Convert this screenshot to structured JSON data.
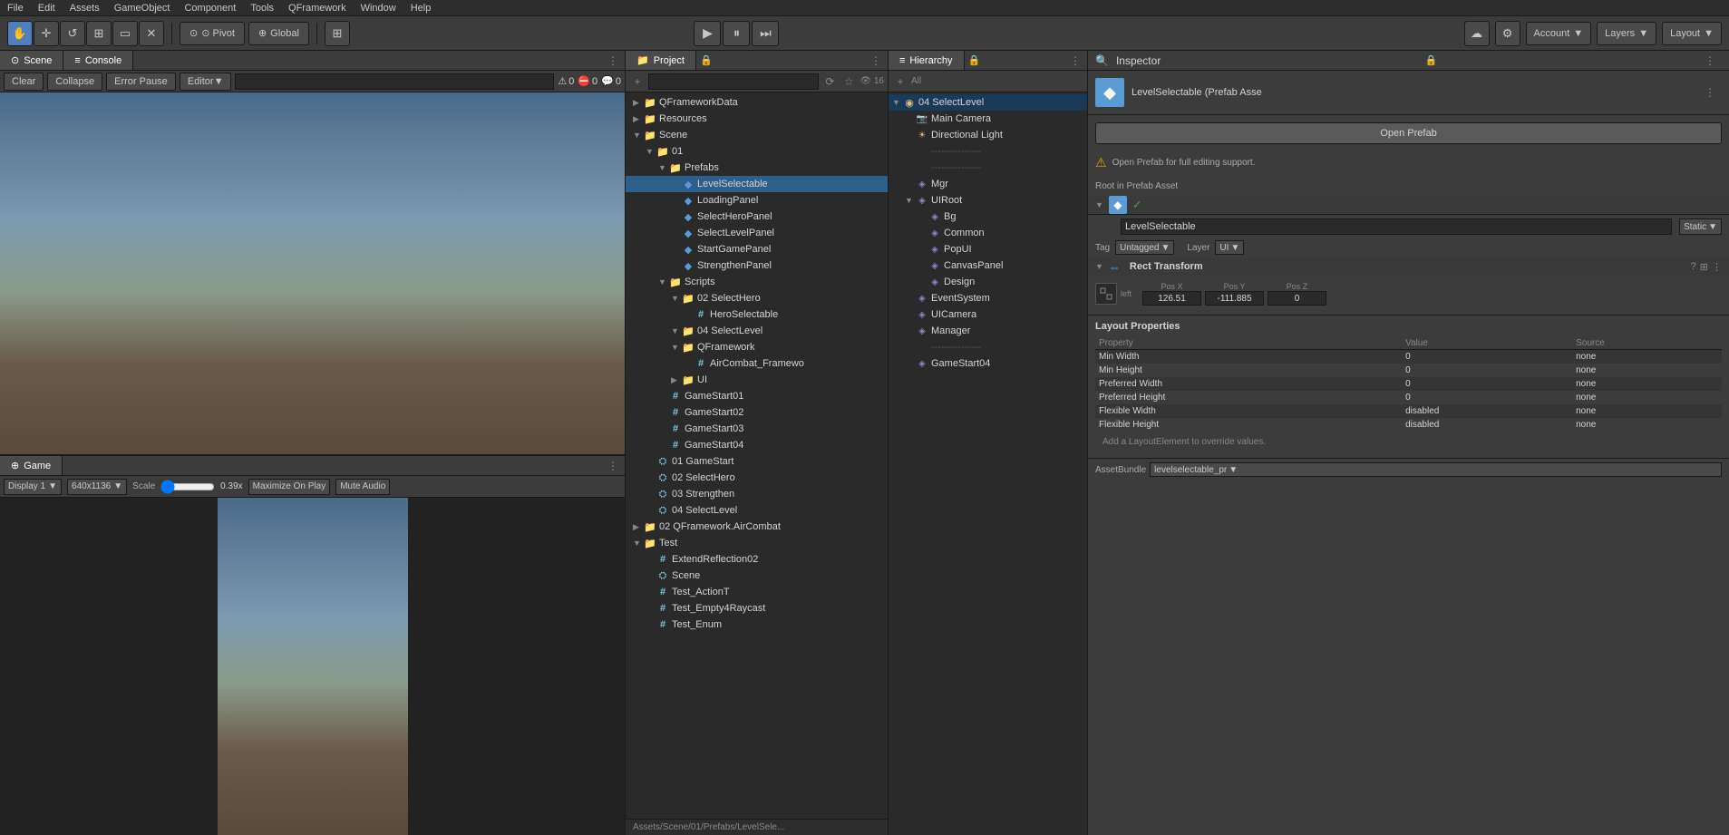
{
  "menubar": {
    "items": [
      "File",
      "Edit",
      "Assets",
      "GameObject",
      "Component",
      "Tools",
      "QFramework",
      "Window",
      "Help"
    ]
  },
  "toolbar": {
    "tools": [
      {
        "name": "hand",
        "icon": "✋",
        "active": true
      },
      {
        "name": "move",
        "icon": "✛",
        "active": false
      },
      {
        "name": "rotate",
        "icon": "↺",
        "active": false
      },
      {
        "name": "scale",
        "icon": "⊞",
        "active": false
      },
      {
        "name": "rect",
        "icon": "▭",
        "active": false
      },
      {
        "name": "transform",
        "icon": "✕",
        "active": false
      }
    ],
    "pivot_label": "⊙ Pivot",
    "global_label": "⊕ Global",
    "collab_icon": "⊞",
    "account_label": "Account",
    "layers_label": "Layers",
    "layout_label": "Layout"
  },
  "play_controls": {
    "play_icon": "▶",
    "pause_icon": "⏸",
    "step_icon": "⏭"
  },
  "scene_tab": {
    "label": "Scene",
    "icon": "⊙"
  },
  "console_tab": {
    "label": "Console",
    "icon": "≡"
  },
  "console_toolbar": {
    "clear_label": "Clear",
    "collapse_label": "Collapse",
    "error_pause_label": "Error Pause",
    "editor_label": "Editor",
    "search_placeholder": "",
    "warn_count": "0",
    "error_count": "0",
    "msg_count": "0"
  },
  "game_tab": {
    "label": "Game",
    "icon": "⊕",
    "display_label": "Display 1",
    "resolution_label": "640x1136",
    "scale_label": "Scale",
    "scale_value": "0.39x",
    "maximize_label": "Maximize On Play",
    "mute_label": "Mute Audio"
  },
  "project_panel": {
    "title": "Project",
    "icon": "📁",
    "count": "16",
    "search_placeholder": "",
    "tree": [
      {
        "id": "qframeworkdata",
        "label": "QFrameworkData",
        "type": "folder",
        "indent": 0,
        "expanded": false,
        "arrow": "▶"
      },
      {
        "id": "resources",
        "label": "Resources",
        "type": "folder",
        "indent": 0,
        "expanded": false,
        "arrow": "▶"
      },
      {
        "id": "scene",
        "label": "Scene",
        "type": "folder",
        "indent": 0,
        "expanded": true,
        "arrow": "▼"
      },
      {
        "id": "01",
        "label": "01",
        "type": "folder",
        "indent": 1,
        "expanded": true,
        "arrow": "▼"
      },
      {
        "id": "prefabs",
        "label": "Prefabs",
        "type": "folder",
        "indent": 2,
        "expanded": true,
        "arrow": "▼"
      },
      {
        "id": "levelselectable",
        "label": "LevelSelectable",
        "type": "prefab",
        "indent": 3,
        "expanded": false,
        "arrow": "",
        "selected": true
      },
      {
        "id": "loadingpanel",
        "label": "LoadingPanel",
        "type": "prefab",
        "indent": 3,
        "expanded": false,
        "arrow": ""
      },
      {
        "id": "selectheropanel",
        "label": "SelectHeroPanel",
        "type": "prefab",
        "indent": 3,
        "expanded": false,
        "arrow": ""
      },
      {
        "id": "selectlevelpanel",
        "label": "SelectLevelPanel",
        "type": "prefab",
        "indent": 3,
        "expanded": false,
        "arrow": ""
      },
      {
        "id": "startgamepanel",
        "label": "StartGamePanel",
        "type": "prefab",
        "indent": 3,
        "expanded": false,
        "arrow": ""
      },
      {
        "id": "strengthenpanel",
        "label": "StrengthenPanel",
        "type": "prefab",
        "indent": 3,
        "expanded": false,
        "arrow": ""
      },
      {
        "id": "scripts",
        "label": "Scripts",
        "type": "folder",
        "indent": 2,
        "expanded": true,
        "arrow": "▼"
      },
      {
        "id": "02selecthero",
        "label": "02 SelectHero",
        "type": "folder",
        "indent": 3,
        "expanded": true,
        "arrow": "▼"
      },
      {
        "id": "heroselectable",
        "label": "HeroSelectable",
        "type": "script",
        "indent": 4,
        "expanded": false,
        "arrow": ""
      },
      {
        "id": "04selectlevel",
        "label": "04 SelectLevel",
        "type": "folder",
        "indent": 3,
        "expanded": true,
        "arrow": "▼"
      },
      {
        "id": "qframework",
        "label": "QFramework",
        "type": "folder",
        "indent": 3,
        "expanded": true,
        "arrow": "▼"
      },
      {
        "id": "aircombat",
        "label": "AirCombat_Framewo",
        "type": "script",
        "indent": 4,
        "expanded": false,
        "arrow": ""
      },
      {
        "id": "ui",
        "label": "UI",
        "type": "folder",
        "indent": 3,
        "expanded": false,
        "arrow": "▶"
      },
      {
        "id": "gamestart01",
        "label": "GameStart01",
        "type": "script",
        "indent": 2,
        "expanded": false,
        "arrow": ""
      },
      {
        "id": "gamestart02",
        "label": "GameStart02",
        "type": "script",
        "indent": 2,
        "expanded": false,
        "arrow": ""
      },
      {
        "id": "gamestart03",
        "label": "GameStart03",
        "type": "script",
        "indent": 2,
        "expanded": false,
        "arrow": ""
      },
      {
        "id": "gamestart04",
        "label": "GameStart04",
        "type": "script",
        "indent": 2,
        "expanded": false,
        "arrow": ""
      },
      {
        "id": "01gamestart",
        "label": "01 GameStart",
        "type": "scene",
        "indent": 1,
        "expanded": false,
        "arrow": ""
      },
      {
        "id": "02selecthero2",
        "label": "02 SelectHero",
        "type": "scene",
        "indent": 1,
        "expanded": false,
        "arrow": ""
      },
      {
        "id": "03strengthen",
        "label": "03 Strengthen",
        "type": "scene",
        "indent": 1,
        "expanded": false,
        "arrow": ""
      },
      {
        "id": "04selectlevel2",
        "label": "04 SelectLevel",
        "type": "scene",
        "indent": 1,
        "expanded": false,
        "arrow": ""
      },
      {
        "id": "02qframework",
        "label": "02 QFramework.AirCombat",
        "type": "folder",
        "indent": 0,
        "expanded": false,
        "arrow": "▶"
      },
      {
        "id": "test",
        "label": "Test",
        "type": "folder",
        "indent": 0,
        "expanded": true,
        "arrow": "▼"
      },
      {
        "id": "extendreflection02",
        "label": "ExtendReflection02",
        "type": "script",
        "indent": 1,
        "expanded": false,
        "arrow": ""
      },
      {
        "id": "scene2",
        "label": "Scene",
        "type": "scene",
        "indent": 1,
        "expanded": false,
        "arrow": ""
      },
      {
        "id": "test_actiont",
        "label": "Test_ActionT",
        "type": "script",
        "indent": 1,
        "expanded": false,
        "arrow": ""
      },
      {
        "id": "test_empty4raycast",
        "label": "Test_Empty4Raycast",
        "type": "script",
        "indent": 1,
        "expanded": false,
        "arrow": ""
      },
      {
        "id": "test_enum",
        "label": "Test_Enum",
        "type": "script",
        "indent": 1,
        "expanded": false,
        "arrow": ""
      }
    ]
  },
  "hierarchy_panel": {
    "title": "Hierarchy",
    "icon": "≡",
    "scene_name": "04 SelectLevel",
    "tree": [
      {
        "id": "allbtn",
        "label": "All",
        "type": "button",
        "indent": 0
      },
      {
        "id": "selectlevel",
        "label": "04 SelectLevel",
        "type": "folder",
        "indent": 0,
        "expanded": true,
        "arrow": "▼",
        "active": true
      },
      {
        "id": "maincamera",
        "label": "Main Camera",
        "type": "camera",
        "indent": 1
      },
      {
        "id": "directionallight",
        "label": "Directional Light",
        "type": "light",
        "indent": 1
      },
      {
        "id": "divider1",
        "label": "---------------",
        "type": "divider",
        "indent": 1
      },
      {
        "id": "divider2",
        "label": "---------------",
        "type": "divider",
        "indent": 1
      },
      {
        "id": "mgr",
        "label": "Mgr",
        "type": "object",
        "indent": 1
      },
      {
        "id": "uiroot",
        "label": "UIRoot",
        "type": "object",
        "indent": 1,
        "expanded": true,
        "arrow": "▼"
      },
      {
        "id": "bg",
        "label": "Bg",
        "type": "object",
        "indent": 2
      },
      {
        "id": "common",
        "label": "Common",
        "type": "object",
        "indent": 2
      },
      {
        "id": "popui",
        "label": "PopUI",
        "type": "object",
        "indent": 2
      },
      {
        "id": "canvaspanel",
        "label": "CanvasPanel",
        "type": "object",
        "indent": 2
      },
      {
        "id": "design",
        "label": "Design",
        "type": "object",
        "indent": 2
      },
      {
        "id": "eventsystem",
        "label": "EventSystem",
        "type": "object",
        "indent": 1
      },
      {
        "id": "uicamera",
        "label": "UICamera",
        "type": "object",
        "indent": 1
      },
      {
        "id": "manager",
        "label": "Manager",
        "type": "object",
        "indent": 1
      },
      {
        "id": "divider3",
        "label": "---------------",
        "type": "divider",
        "indent": 1
      },
      {
        "id": "gamestart04",
        "label": "GameStart04",
        "type": "object",
        "indent": 1
      }
    ]
  },
  "inspector_panel": {
    "title": "Inspector",
    "icon": "🔍",
    "object_name": "LevelSelectable (Prefab Asse",
    "object_icon": "◆",
    "open_prefab_label": "Open Prefab",
    "warning_text": "Open Prefab for full editing support.",
    "root_prefab_text": "Root in Prefab Asset",
    "component_name": "LevelSelectable",
    "static_label": "Static",
    "tag_label": "Tag",
    "tag_value": "Untagged",
    "layer_label": "Layer",
    "layer_value": "UI",
    "rect_transform_label": "Rect Transform",
    "pos_x_label": "Pos X",
    "pos_y_label": "Pos Y",
    "pos_z_label": "Pos Z",
    "pos_x_value": "126.51",
    "pos_y_value": "-111.885",
    "pos_z_value": "0",
    "left_label": "left",
    "layout_props_title": "Layout Properties",
    "layout_columns": [
      "Property",
      "Value",
      "Source"
    ],
    "layout_rows": [
      {
        "property": "Min Width",
        "value": "0",
        "source": "none"
      },
      {
        "property": "Min Height",
        "value": "0",
        "source": "none"
      },
      {
        "property": "Preferred Width",
        "value": "0",
        "source": "none"
      },
      {
        "property": "Preferred Height",
        "value": "0",
        "source": "none"
      },
      {
        "property": "Flexible Width",
        "value": "disabled",
        "source": "none"
      },
      {
        "property": "Flexible Height",
        "value": "disabled",
        "source": "none"
      }
    ],
    "add_layout_text": "Add a LayoutElement to override values.",
    "asset_bundle_label": "AssetBundle",
    "asset_bundle_value": "levelselectable_pr"
  },
  "status_bar": {
    "path": "Assets/Scene/01/Prefabs/LevelSele..."
  },
  "colors": {
    "accent_blue": "#4f7fbf",
    "prefab_blue": "#5b9bd5",
    "folder_yellow": "#e0c070",
    "script_cyan": "#7ec8e3",
    "selected_bg": "#2c5f8a",
    "active_bg": "#1a3a5a"
  }
}
